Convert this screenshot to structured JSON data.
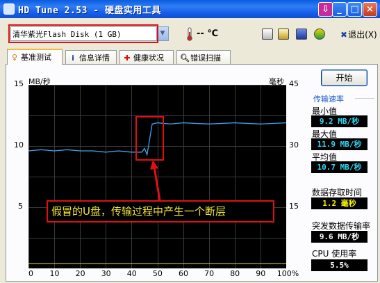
{
  "window": {
    "title": "HD Tune 2.53 - 硬盘实用工具",
    "titlebar_colors": {
      "bar": "#1660e8",
      "close": "#c8391b"
    }
  },
  "toolbar": {
    "drive": "清华紫光Flash Disk (1 GB)",
    "temperature": "-- ℃",
    "exit_label": "退出(X)",
    "icons": [
      "copy-icon",
      "paste-icon",
      "save-icon",
      "options-icon",
      "exit-icon"
    ]
  },
  "tabs": [
    {
      "label": "基准测试",
      "icon": "benchmark-icon",
      "active": true
    },
    {
      "label": "信息详情",
      "icon": "info-icon",
      "active": false
    },
    {
      "label": "健康状况",
      "icon": "health-icon",
      "active": false
    },
    {
      "label": "错误扫描",
      "icon": "scan-icon",
      "active": false
    }
  ],
  "benchmark": {
    "start_label": "开始",
    "transfer_rate_title": "传输速率",
    "min_label": "最小值",
    "min_value": "9.2 MB/秒",
    "max_label": "最大值",
    "max_value": "11.9 MB/秒",
    "avg_label": "平均值",
    "avg_value": "10.7 MB/秒",
    "access_time_label": "数据存取时间",
    "access_time_value": "1.2 毫秒",
    "burst_rate_label": "突发数据传输率",
    "burst_rate_value": "9.6 MB/秒",
    "cpu_label": "CPU 使用率",
    "cpu_value": "5.5%"
  },
  "annotation": {
    "text": "假冒的U盘，传输过程中产生一个断层",
    "color": "#e01010",
    "text_color": "#f4e830"
  },
  "chart_data": {
    "type": "line",
    "left_axis_label": "MB/秒",
    "right_axis_label": "毫秒",
    "left_ticks": [
      "15",
      "10",
      "5"
    ],
    "right_ticks": [
      "45",
      "30",
      "15"
    ],
    "x_ticks": [
      "0",
      "10",
      "20",
      "30",
      "40",
      "50",
      "60",
      "70",
      "80",
      "90",
      "100%"
    ],
    "ylim": [
      0,
      15
    ],
    "y2lim": [
      0,
      45
    ],
    "xlim": [
      0,
      100
    ],
    "series": [
      {
        "color": "#3fa6f0",
        "x": [
          0,
          5,
          10,
          15,
          20,
          25,
          30,
          35,
          40,
          43,
          44,
          45,
          46,
          48,
          50,
          55,
          60,
          70,
          80,
          90,
          100
        ],
        "y": [
          9.6,
          9.7,
          9.6,
          9.7,
          9.6,
          9.6,
          9.5,
          9.6,
          9.5,
          9.5,
          9.5,
          9.8,
          9.3,
          11.8,
          11.9,
          11.8,
          11.9,
          11.8,
          11.9,
          11.8,
          11.9
        ]
      },
      {
        "color": "#e8e020",
        "x": [
          0,
          10,
          20,
          30,
          40,
          50,
          60,
          70,
          80,
          90,
          100
        ],
        "y": [
          0.4,
          0.4,
          0.4,
          0.4,
          0.4,
          0.4,
          0.4,
          0.4,
          0.4,
          0.4,
          0.4
        ]
      }
    ],
    "grid": true
  }
}
